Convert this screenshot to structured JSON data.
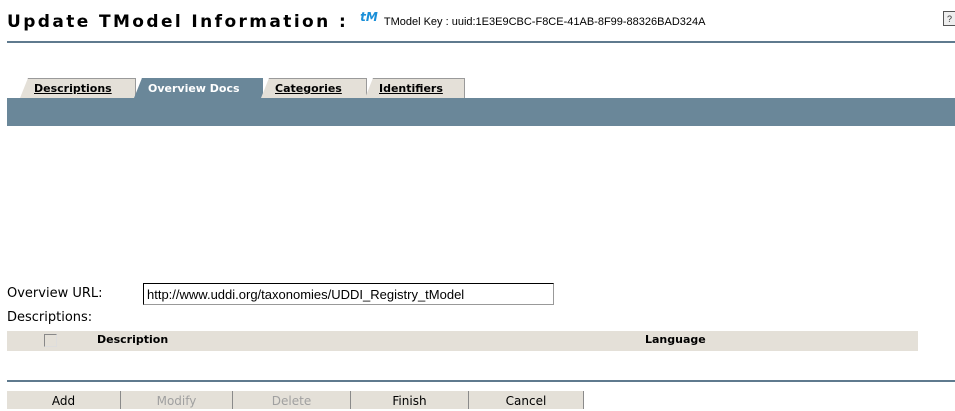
{
  "header": {
    "title": "Update TModel Information :",
    "tm_icon_text": "tM",
    "tmodel_key": "TModel Key : uuid:1E3E9CBC-F8CE-41AB-8F99-88326BAD324A",
    "help_icon": "?"
  },
  "tabs": [
    {
      "label": "Descriptions",
      "active": false
    },
    {
      "label": "Overview Docs",
      "active": true
    },
    {
      "label": "Categories",
      "active": false
    },
    {
      "label": "Identifiers",
      "active": false
    }
  ],
  "form": {
    "overview_url_label": "Overview URL:",
    "overview_url_value": "http://www.uddi.org/taxonomies/UDDI_Registry_tModel",
    "descriptions_label": "Descriptions:"
  },
  "table": {
    "columns": [
      "Description",
      "Language"
    ]
  },
  "buttons": [
    {
      "label": "Add",
      "enabled": true
    },
    {
      "label": "Modify",
      "enabled": false
    },
    {
      "label": "Delete",
      "enabled": false
    },
    {
      "label": "Finish",
      "enabled": true
    },
    {
      "label": "Cancel",
      "enabled": true
    }
  ],
  "colors": {
    "accent_bar": "#6a8799",
    "tab_bg": "#e4e0d8",
    "tm_icon": "#1a8fd8"
  }
}
